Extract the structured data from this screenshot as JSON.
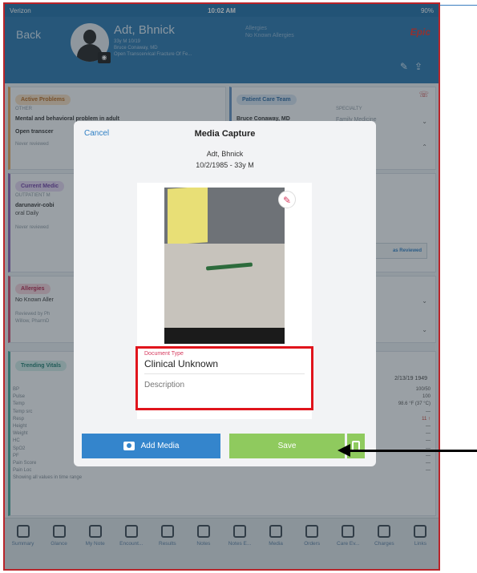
{
  "status_bar": {
    "carrier": "Verizon",
    "time": "10:02 AM",
    "battery": "90%"
  },
  "header": {
    "back_label": "Back",
    "patient_name": "Adt, Bhnick",
    "patient_age_sex": "33y M  10/19",
    "pcp": "Bruce Conaway, MD",
    "diagnosis": "Open Transcervical Fracture Of Fe...",
    "allergies_label": "Allergies",
    "allergies_value": "No Known Allergies",
    "brand": "Epic"
  },
  "background": {
    "active_problems": {
      "title": "Active Problems",
      "category": "OTHER",
      "item1": "Mental and behavioral problem in adult",
      "item2": "Open transcer",
      "reviewed": "Never reviewed"
    },
    "care_team": {
      "title": "Patient Care Team",
      "specialty_header": "SPECIALTY",
      "member": "Bruce Conaway, MD",
      "specialty": "Family Medicine"
    },
    "medications": {
      "title": "Current Medic",
      "subheader": "OUTPATIENT M",
      "item": "darunavir-cobi",
      "dose": "oral Daily",
      "reviewed": "Never reviewed",
      "mark_reviewed": "as Reviewed"
    },
    "allergies": {
      "title": "Allergies",
      "item": "No Known Aller",
      "reviewed1": "Reviewed by Ph",
      "reviewed2": "Willow, PharmD"
    },
    "vitals": {
      "title": "Trending Vitals",
      "date": "2/13/19 1949",
      "labels": [
        "BP",
        "Pulse",
        "Temp",
        "Temp src",
        "Resp",
        "Height",
        "Weight",
        "HC",
        "SpO2",
        "PF",
        "Pain Score",
        "Pain Loc"
      ],
      "values": [
        "100/50",
        "100",
        "98.6 °F (37 °C)",
        "—",
        "11 ↑",
        "—",
        "—",
        "—",
        "—",
        "—",
        "—",
        "—"
      ],
      "footer": "Showing all values in time range"
    }
  },
  "modal": {
    "cancel_label": "Cancel",
    "title": "Media Capture",
    "patient_name": "Adt, Bhnick",
    "patient_dob": "10/2/1985 - 33y M",
    "doc_type_label": "Document Type",
    "doc_type_value": "Clinical Unknown",
    "description_placeholder": "Description",
    "add_media_label": "Add Media",
    "save_label": "Save"
  },
  "tabs": [
    {
      "label": "Summary"
    },
    {
      "label": "Glance"
    },
    {
      "label": "My Note"
    },
    {
      "label": "Encount..."
    },
    {
      "label": "Results"
    },
    {
      "label": "Notes"
    },
    {
      "label": "Notes E..."
    },
    {
      "label": "Media"
    },
    {
      "label": "Orders"
    },
    {
      "label": "Care Ev..."
    },
    {
      "label": "Charges"
    },
    {
      "label": "Links"
    }
  ],
  "colors": {
    "header_blue": "#2775ad",
    "accent_red": "#e0141c",
    "save_green": "#8fca5e",
    "add_media_blue": "#3485cc"
  }
}
